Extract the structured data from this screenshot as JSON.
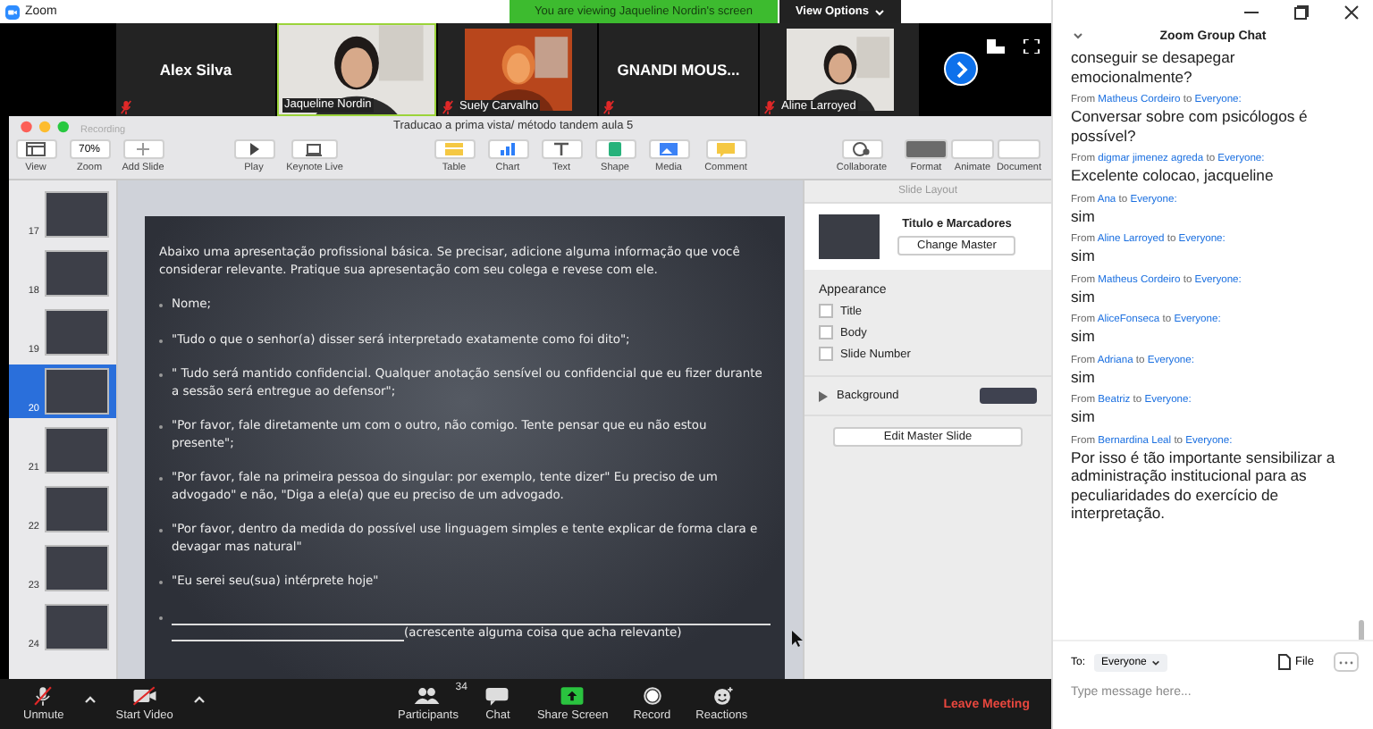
{
  "app_title": "Zoom",
  "share_banner": "You are viewing Jaqueline Nordin's screen",
  "view_options": "View Options",
  "participants": [
    {
      "name": "Alex Silva",
      "video": false,
      "muted": true,
      "speaking": false
    },
    {
      "name": "Jaqueline Nordin",
      "video": true,
      "muted": false,
      "speaking": true
    },
    {
      "name": "Suely Carvalho",
      "video": true,
      "muted": true,
      "speaking": false
    },
    {
      "name": "GNANDI  MOUS...",
      "video": false,
      "muted": true,
      "speaking": false
    },
    {
      "name": "Aline Larroyed",
      "video": true,
      "muted": true,
      "speaking": false
    }
  ],
  "keynote": {
    "title": "Traducao a prima vista/ método tandem aula 5",
    "recording": "Recording",
    "toolbar": [
      {
        "label": "View",
        "kind": "view"
      },
      {
        "label": "Zoom",
        "kind": "zoom",
        "value": "70%"
      },
      {
        "label": "Add Slide",
        "kind": "add"
      },
      {
        "label": "Play",
        "kind": "play"
      },
      {
        "label": "Keynote Live",
        "kind": "live"
      },
      {
        "label": "Table",
        "kind": "table"
      },
      {
        "label": "Chart",
        "kind": "chart"
      },
      {
        "label": "Text",
        "kind": "text"
      },
      {
        "label": "Shape",
        "kind": "shape"
      },
      {
        "label": "Media",
        "kind": "media"
      },
      {
        "label": "Comment",
        "kind": "comment"
      },
      {
        "label": "Collaborate",
        "kind": "collab"
      }
    ],
    "inspector_tabs": [
      {
        "label": "Format",
        "selected": true
      },
      {
        "label": "Animate",
        "selected": false
      },
      {
        "label": "Document",
        "selected": false
      }
    ],
    "slides": [
      {
        "number": "17",
        "selected": false
      },
      {
        "number": "18",
        "selected": false
      },
      {
        "number": "19",
        "selected": false
      },
      {
        "number": "20",
        "selected": true
      },
      {
        "number": "21",
        "selected": false
      },
      {
        "number": "22",
        "selected": false
      },
      {
        "number": "23",
        "selected": false
      },
      {
        "number": "24",
        "selected": false
      }
    ],
    "slide": {
      "intro": "Abaixo uma apresentação profissional básica. Se precisar, adicione alguma informação que você considerar relevante. Pratique sua apresentação com seu colega e revese com ele.",
      "items": [
        {
          "kind": "text",
          "text": "Nome;"
        },
        {
          "kind": "text",
          "text": "\"Tudo o que o senhor(a) disser será interpretado exatamente como foi dito\";"
        },
        {
          "kind": "text",
          "text": "\" Tudo será mantido confidencial. Qualquer anotação sensível ou confidencial que eu fizer durante a sessão será entregue ao defensor\";"
        },
        {
          "kind": "text",
          "text": "\"Por favor, fale diretamente um com o outro, não comigo. Tente pensar que eu não estou presente\";"
        },
        {
          "kind": "text",
          "text": "\"Por favor, fale na primeira pessoa do singular: por exemplo, tente dizer\" Eu preciso de um advogado\" e não, \"Diga a ele(a) que eu preciso de um advogado."
        },
        {
          "kind": "text",
          "text": "\"Por favor, dentro da medida do possível use linguagem simples e tente explicar de forma clara e devagar mas natural\""
        },
        {
          "kind": "text",
          "text": "\"Eu serei seu(sua) intérprete hoje\""
        },
        {
          "kind": "blank",
          "text": "(acrescente alguma coisa que acha relevante)"
        }
      ]
    },
    "inspector": {
      "header": "Slide Layout",
      "layout_name": "Titulo e Marcadores",
      "change_master": "Change Master",
      "appearance": "Appearance",
      "options": [
        {
          "label": "Title",
          "checked": false
        },
        {
          "label": "Body",
          "checked": false
        },
        {
          "label": "Slide Number",
          "checked": false
        }
      ],
      "background": "Background",
      "edit_master": "Edit Master Slide"
    }
  },
  "toolbar": [
    {
      "label": "Unmute",
      "kind": "mic"
    },
    {
      "label": "Start Video",
      "kind": "video"
    },
    {
      "label": "Participants",
      "kind": "people",
      "count": "34"
    },
    {
      "label": "Chat",
      "kind": "chat"
    },
    {
      "label": "Share Screen",
      "kind": "share"
    },
    {
      "label": "Record",
      "kind": "record"
    },
    {
      "label": "Reactions",
      "kind": "react"
    }
  ],
  "leave": "Leave Meeting",
  "chat": {
    "title": "Zoom Group Chat",
    "messages": [
      {
        "text": "conseguir se desapegar emocionalmente?"
      },
      {
        "from_word": "From",
        "from": "Matheus Cordeiro",
        "to_word": "to",
        "to": "Everyone:",
        "text": "Conversar sobre com psicólogos é possível?"
      },
      {
        "from_word": "From",
        "from": "digmar jimenez agreda",
        "to_word": "to",
        "to": "Everyone:",
        "text": "Excelente colocao, jacqueline"
      },
      {
        "from_word": "From",
        "from": "Ana",
        "to_word": "to",
        "to": "Everyone:",
        "text": "sim"
      },
      {
        "from_word": "From",
        "from": "Aline Larroyed",
        "to_word": "to",
        "to": "Everyone:",
        "text": "sim"
      },
      {
        "from_word": "From",
        "from": "Matheus Cordeiro",
        "to_word": "to",
        "to": "Everyone:",
        "text": "sim"
      },
      {
        "from_word": "From",
        "from": "AliceFonseca",
        "to_word": "to",
        "to": "Everyone:",
        "text": "sim"
      },
      {
        "from_word": "From",
        "from": "Adriana",
        "to_word": "to",
        "to": "Everyone:",
        "text": "sim"
      },
      {
        "from_word": "From",
        "from": "Beatriz",
        "to_word": "to",
        "to": "Everyone:",
        "text": "sim"
      },
      {
        "from_word": "From",
        "from": "Bernardina Leal",
        "to_word": "to",
        "to": "Everyone:",
        "text": "Por isso é tão importante sensibilizar a administração institucional para as peculiaridades do exercício de interpretação."
      }
    ],
    "to_label": "To:",
    "recipient": "Everyone",
    "file": "File",
    "placeholder": "Type message here..."
  }
}
